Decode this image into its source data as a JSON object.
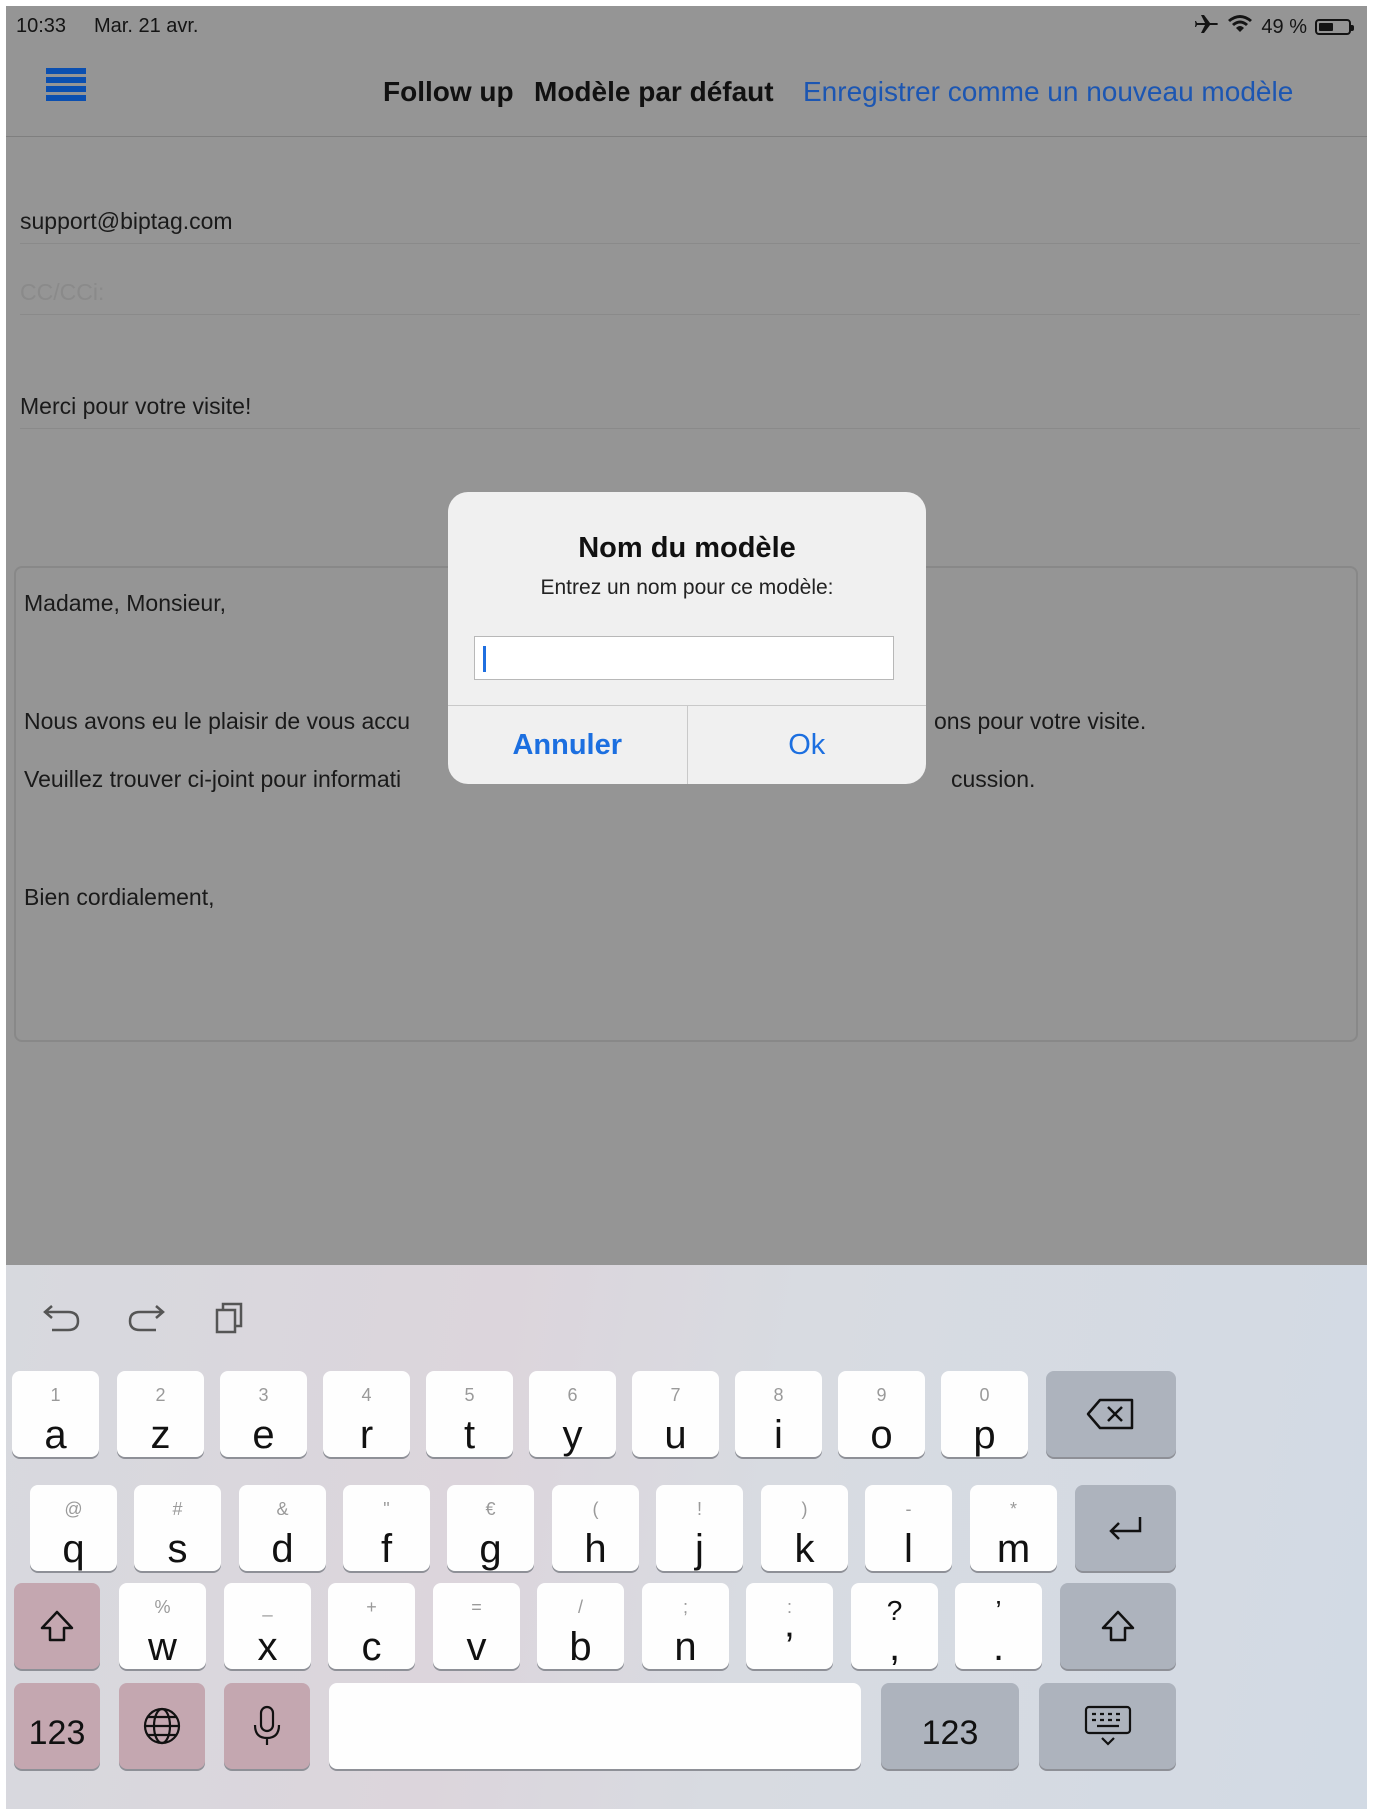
{
  "status_bar": {
    "time": "10:33",
    "date": "Mar. 21 avr.",
    "battery_percent": "49 %"
  },
  "nav": {
    "title": "Follow up",
    "subtitle": "Modèle par défaut",
    "save_link": "Enregistrer comme un nouveau modèle"
  },
  "form": {
    "to": "support@biptag.com",
    "cc_placeholder": "CC/CCi:",
    "subject": "Merci pour votre visite!",
    "body_lines": [
      "Madame, Monsieur,",
      "Nous avons eu le plaisir de vous accu",
      "ons pour votre visite.",
      "Veuillez trouver ci-joint pour informati",
      "cussion.",
      "Bien cordialement,"
    ]
  },
  "dialog": {
    "title": "Nom du modèle",
    "message": "Entrez un nom pour ce modèle:",
    "input_value": "",
    "cancel": "Annuler",
    "ok": "Ok"
  },
  "keyboard": {
    "tools": [
      "undo-icon",
      "redo-icon",
      "paste-icon"
    ],
    "row1": [
      {
        "char": "a",
        "hint": "1"
      },
      {
        "char": "z",
        "hint": "2"
      },
      {
        "char": "e",
        "hint": "3"
      },
      {
        "char": "r",
        "hint": "4"
      },
      {
        "char": "t",
        "hint": "5"
      },
      {
        "char": "y",
        "hint": "6"
      },
      {
        "char": "u",
        "hint": "7"
      },
      {
        "char": "i",
        "hint": "8"
      },
      {
        "char": "o",
        "hint": "9"
      },
      {
        "char": "p",
        "hint": "0"
      }
    ],
    "row2": [
      {
        "char": "q",
        "hint": "@"
      },
      {
        "char": "s",
        "hint": "#"
      },
      {
        "char": "d",
        "hint": "&"
      },
      {
        "char": "f",
        "hint": "\""
      },
      {
        "char": "g",
        "hint": "€"
      },
      {
        "char": "h",
        "hint": "("
      },
      {
        "char": "j",
        "hint": "!"
      },
      {
        "char": "k",
        "hint": ")"
      },
      {
        "char": "l",
        "hint": "-"
      },
      {
        "char": "m",
        "hint": "*"
      }
    ],
    "row3": [
      {
        "char": "w",
        "hint": "%"
      },
      {
        "char": "x",
        "hint": "_"
      },
      {
        "char": "c",
        "hint": "+"
      },
      {
        "char": "v",
        "hint": "="
      },
      {
        "char": "b",
        "hint": "/"
      },
      {
        "char": "n",
        "hint": ";"
      },
      {
        "char": "’",
        "hint": ":"
      },
      {
        "char": ",",
        "hint": "?"
      },
      {
        "char": ".",
        "hint": "’"
      }
    ],
    "numbers_label": "123",
    "numbers_label_right": "123",
    "colors": {
      "accent": "#1c6fe0",
      "link": "#1c56b2",
      "dim_overlay": "#959595"
    }
  }
}
